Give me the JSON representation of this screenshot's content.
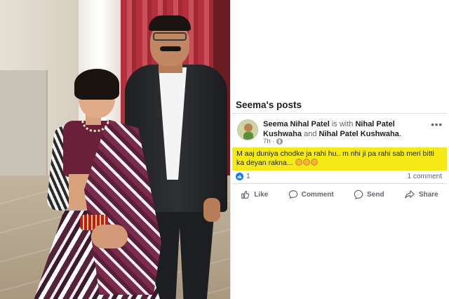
{
  "profile": {
    "posts_heading": "Seema's posts"
  },
  "post": {
    "author": "Seema Nihal Patel",
    "with_text": "is with",
    "tagged_1": "Nihal Patel Kushwaha",
    "and_text": "and",
    "tagged_2": "Nihal Patel Kushwaha",
    "period": ".",
    "time": "7h ·",
    "body": "M aaj duniya chodke ja rahi hu.. m nhi ji pa rahi sab meri bitti ka deyan rakna...",
    "reaction_count": "1",
    "comments_label": "1 comment",
    "highlight_color": "#f5ea17"
  },
  "actions": {
    "like_label": "Like",
    "comment_label": "Comment",
    "send_label": "Send",
    "share_label": "Share"
  },
  "colors": {
    "facebook_blue": "#1877f2",
    "text_secondary": "#606770"
  },
  "icons": [
    "more-options-icon",
    "globe-icon",
    "like-reaction-icon",
    "crying-emoji-icon",
    "thumbs-up-icon",
    "comment-icon",
    "messenger-icon",
    "share-icon"
  ]
}
